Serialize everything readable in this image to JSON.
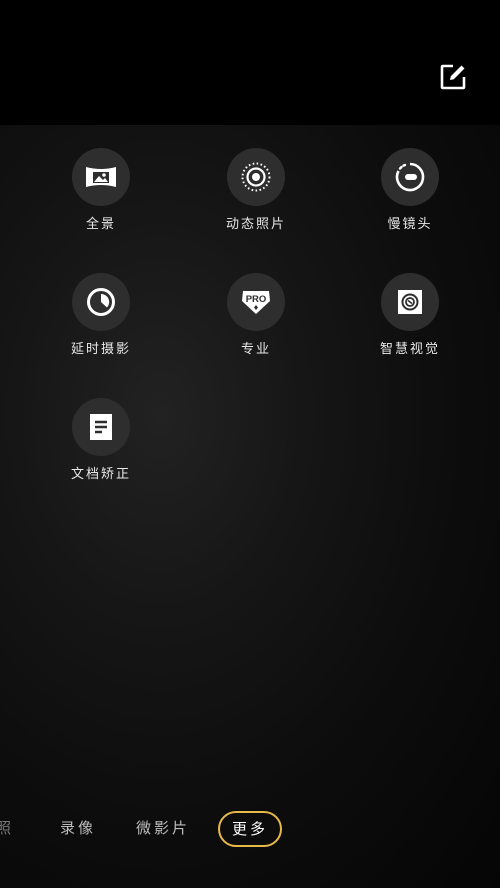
{
  "header": {
    "edit_icon": "edit-icon"
  },
  "modes": [
    {
      "label": "全景",
      "icon": "panorama-icon"
    },
    {
      "label": "动态照片",
      "icon": "live-photo-icon"
    },
    {
      "label": "慢镜头",
      "icon": "slow-motion-icon"
    },
    {
      "label": "延时摄影",
      "icon": "timelapse-icon"
    },
    {
      "label": "专业",
      "icon": "pro-mode-icon"
    },
    {
      "label": "智慧视觉",
      "icon": "smart-vision-icon"
    },
    {
      "label": "文档矫正",
      "icon": "document-correction-icon"
    }
  ],
  "pro_badge_text": "PRO",
  "tabs": [
    {
      "label": "照",
      "active": false
    },
    {
      "label": "录像",
      "active": false
    },
    {
      "label": "微影片",
      "active": false
    },
    {
      "label": "更多",
      "active": true
    }
  ],
  "colors": {
    "accent": "#e7b94b",
    "circle_bg": "#2e2e2e",
    "background": "#000000"
  }
}
